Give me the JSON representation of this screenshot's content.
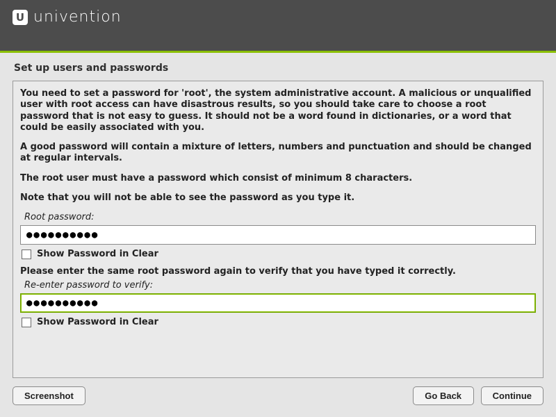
{
  "brand": {
    "logo_letter": "U",
    "name": "univention"
  },
  "page": {
    "title": "Set up users and passwords"
  },
  "instructions": {
    "p1": "You need to set a password for 'root', the system administrative account. A malicious or unqualified user with root access can have disastrous results, so you should take care to choose a root password that is not easy to guess. It should not be a word found in dictionaries, or a word that could be easily associated with you.",
    "p2": "A good password will contain a mixture of letters, numbers and punctuation and should be changed at regular intervals.",
    "p3": "The root user must have a password which consist of minimum 8 characters.",
    "p4": "Note that you will not be able to see the password as you type it."
  },
  "fields": {
    "root_password": {
      "label": "Root password:",
      "value": "●●●●●●●●●●",
      "show_clear_label": "Show Password in Clear"
    },
    "verify_prompt": "Please enter the same root password again to verify that you have typed it correctly.",
    "verify_password": {
      "label": "Re-enter password to verify:",
      "value": "●●●●●●●●●●",
      "show_clear_label": "Show Password in Clear"
    }
  },
  "buttons": {
    "screenshot": "Screenshot",
    "go_back": "Go Back",
    "continue": "Continue"
  }
}
